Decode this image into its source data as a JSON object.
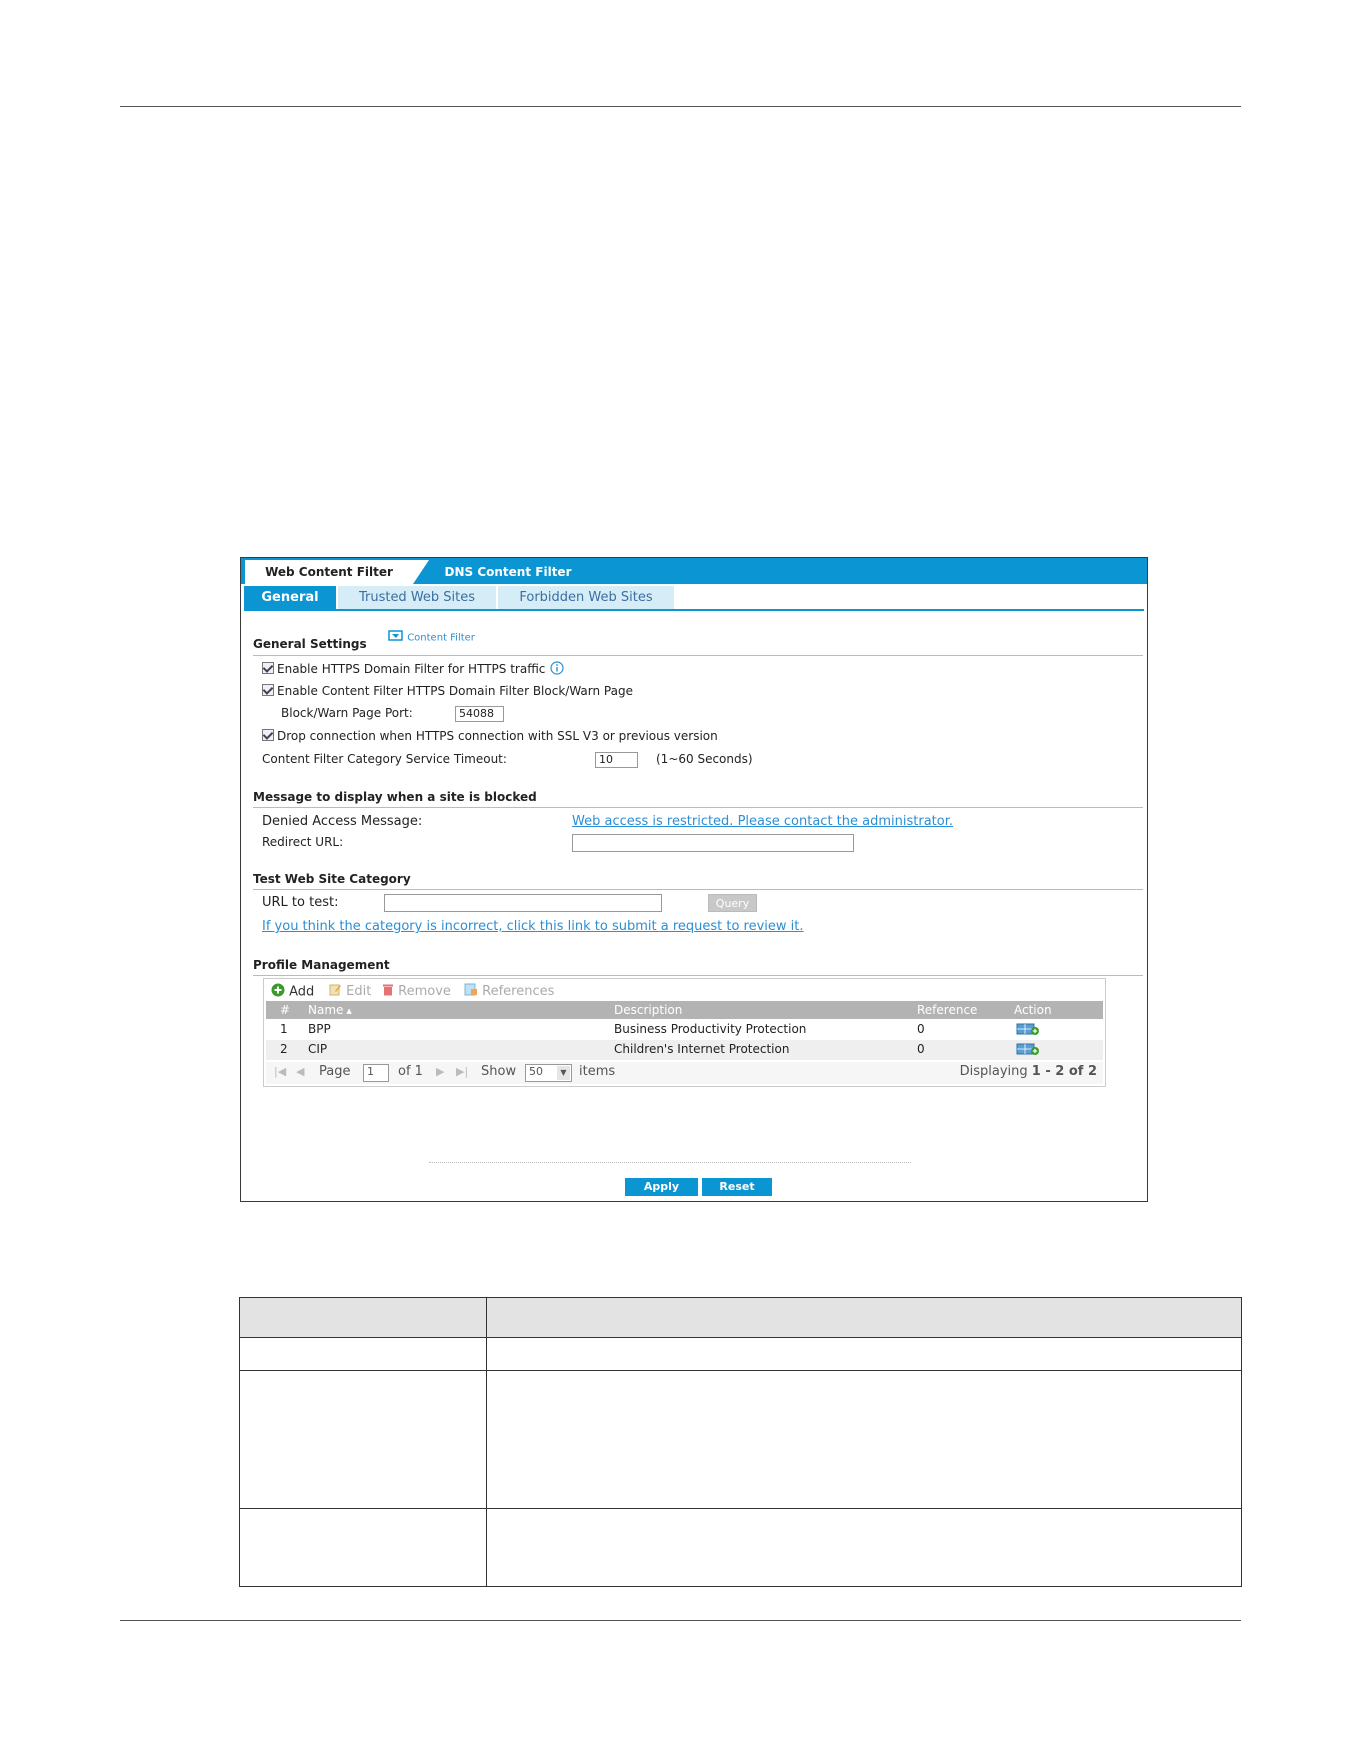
{
  "window": {
    "main_tabs": [
      "Web Content Filter",
      "DNS Content Filter"
    ],
    "sub_tabs": [
      "General",
      "Trusted Web Sites",
      "Forbidden Web Sites"
    ]
  },
  "general_settings": {
    "title": "General Settings",
    "content_filter_link": "Content Filter",
    "https_domain_filter": "Enable HTTPS Domain Filter for HTTPS traffic",
    "block_warn_page": "Enable Content Filter HTTPS Domain Filter Block/Warn Page",
    "port_label": "Block/Warn Page Port:",
    "port_value": "54088",
    "drop_connection": "Drop connection when HTTPS connection with SSL V3 or previous version",
    "timeout_label": "Content Filter Category Service Timeout:",
    "timeout_value": "10",
    "timeout_range": "(1~60 Seconds)"
  },
  "blocked_message": {
    "title": "Message to display when a site is blocked",
    "denied_label": "Denied Access Message:",
    "denied_value": "Web access is restricted. Please contact the administrator.",
    "redirect_label": "Redirect URL:",
    "redirect_value": ""
  },
  "test_site": {
    "title": "Test Web Site Category",
    "url_label": "URL to test:",
    "url_value": "",
    "query_button": "Query",
    "review_link": "If you think the category is incorrect, click this link to submit a request to review it."
  },
  "profile_management": {
    "title": "Profile Management",
    "toolbar": {
      "add": "Add",
      "edit": "Edit",
      "remove": "Remove",
      "references": "References"
    },
    "columns": [
      "#",
      "Name",
      "Description",
      "Reference",
      "Action"
    ],
    "rows": [
      {
        "num": "1",
        "name": "BPP",
        "description": "Business Productivity Protection",
        "reference": "0"
      },
      {
        "num": "2",
        "name": "CIP",
        "description": "Children's Internet Protection",
        "reference": "0"
      }
    ],
    "pager": {
      "page_label": "Page",
      "page_value": "1",
      "of_label": "of 1",
      "show_label": "Show",
      "show_value": "50",
      "items_label": "items",
      "displaying": "Displaying",
      "range": "1 - 2 of 2"
    }
  },
  "actions": {
    "apply": "Apply",
    "reset": "Reset"
  },
  "colors": {
    "accent": "#0b95d3",
    "link": "#2a8fd6",
    "add_green": "#3a9a2a",
    "remove_red": "#d9534f"
  }
}
